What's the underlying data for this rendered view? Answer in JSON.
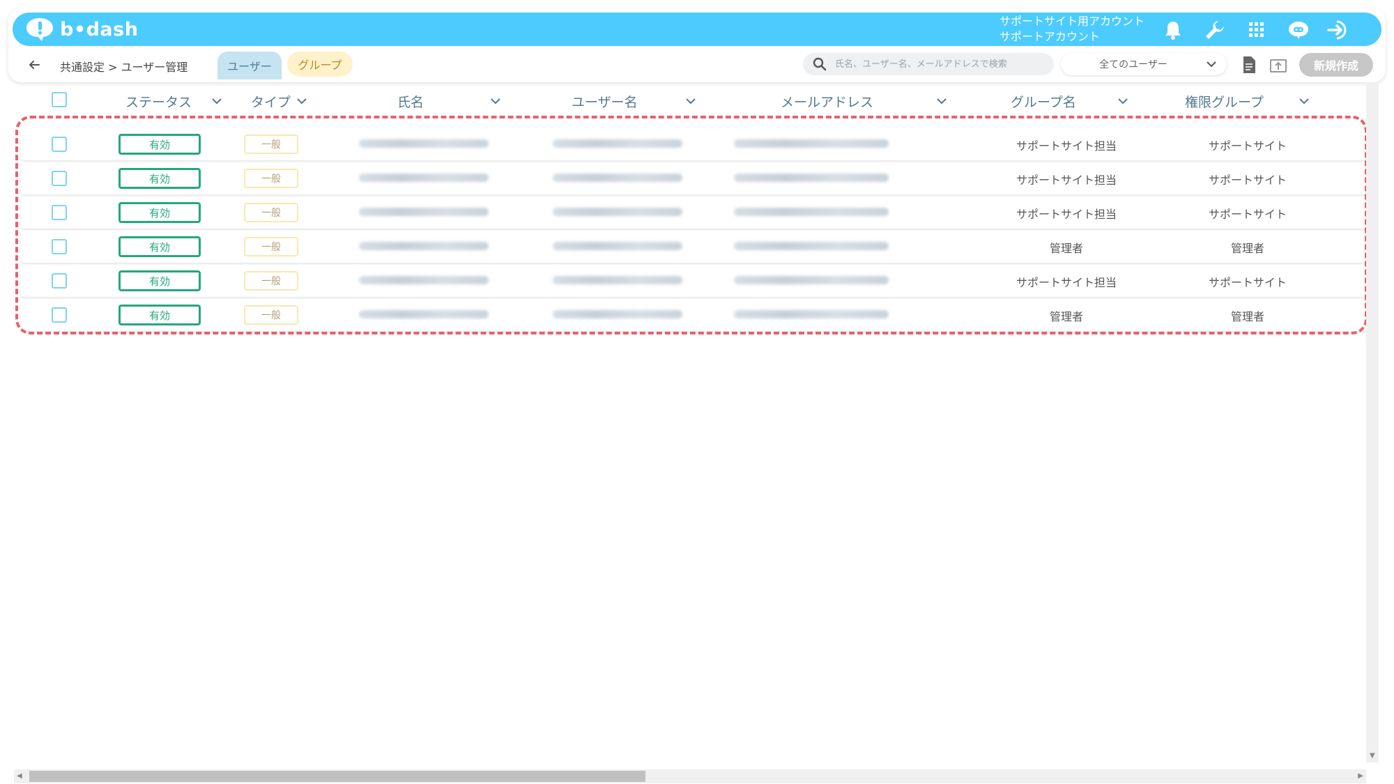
{
  "header": {
    "logo_text": "b•dash",
    "account_line1": "サポートサイト用アカウント",
    "account_line2": "サポートアカウント",
    "icons": [
      "bell-icon",
      "wrench-icon",
      "grid-icon",
      "chat-robot-icon",
      "logout-icon"
    ],
    "brand_color": "#4ccbff"
  },
  "nav": {
    "breadcrumb": "共通設定 > ユーザー管理",
    "tabs": [
      {
        "label": "ユーザー",
        "active": true
      },
      {
        "label": "グループ",
        "active": false
      }
    ],
    "search_placeholder": "氏名、ユーザー名、メールアドレスで検索",
    "filter_value": "全てのユーザー",
    "new_button_label": "新規作成"
  },
  "table": {
    "columns": [
      "ステータス",
      "タイプ",
      "氏名",
      "ユーザー名",
      "メールアドレス",
      "グループ名",
      "権限グループ"
    ],
    "rows": [
      {
        "status": "有効",
        "type": "一般",
        "group": "サポートサイト担当",
        "role": "サポートサイト"
      },
      {
        "status": "有効",
        "type": "一般",
        "group": "サポートサイト担当",
        "role": "サポートサイト"
      },
      {
        "status": "有効",
        "type": "一般",
        "group": "サポートサイト担当",
        "role": "サポートサイト"
      },
      {
        "status": "有効",
        "type": "一般",
        "group": "管理者",
        "role": "管理者"
      },
      {
        "status": "有効",
        "type": "一般",
        "group": "サポートサイト担当",
        "role": "サポートサイト"
      },
      {
        "status": "有効",
        "type": "一般",
        "group": "管理者",
        "role": "管理者"
      }
    ],
    "status_color": "#25a77a",
    "highlight_color": "#e8616c"
  }
}
